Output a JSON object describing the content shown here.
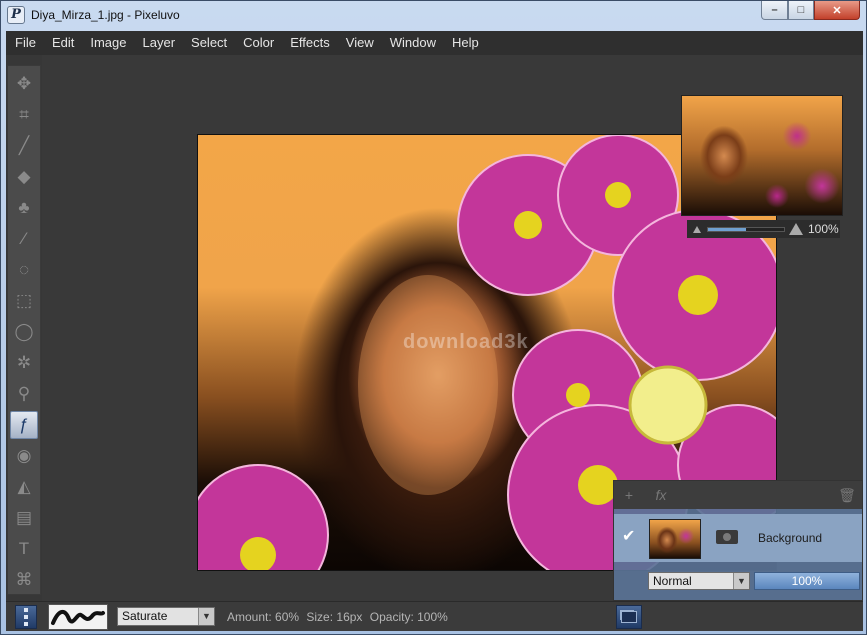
{
  "window": {
    "title": "Diya_Mirza_1.jpg - Pixeluvo",
    "app_icon": "P",
    "minimize": "–",
    "maximize": "□",
    "close": "✕"
  },
  "menu": [
    "File",
    "Edit",
    "Image",
    "Layer",
    "Select",
    "Color",
    "Effects",
    "View",
    "Window",
    "Help"
  ],
  "tools": [
    {
      "name": "move-icon",
      "glyph": "✥"
    },
    {
      "name": "crop-icon",
      "glyph": "⌗"
    },
    {
      "name": "brush-icon",
      "glyph": "╱"
    },
    {
      "name": "eraser-icon",
      "glyph": "◆"
    },
    {
      "name": "clone-stamp-icon",
      "glyph": "♣"
    },
    {
      "name": "heal-icon",
      "glyph": "⁄"
    },
    {
      "name": "lasso-icon",
      "glyph": "◌"
    },
    {
      "name": "rect-select-icon",
      "glyph": "⬚"
    },
    {
      "name": "ellipse-select-icon",
      "glyph": "◯"
    },
    {
      "name": "magic-wand-icon",
      "glyph": "✲"
    },
    {
      "name": "smudge-icon",
      "glyph": "⚲"
    },
    {
      "name": "effects-brush-icon",
      "glyph": "ƒ"
    },
    {
      "name": "red-eye-icon",
      "glyph": "◉"
    },
    {
      "name": "fill-bucket-icon",
      "glyph": "◭"
    },
    {
      "name": "gradient-icon",
      "glyph": "▤"
    },
    {
      "name": "text-icon",
      "glyph": "T"
    },
    {
      "name": "transform-icon",
      "glyph": "⌘"
    }
  ],
  "active_tool_index": 11,
  "canvas": {
    "watermark": "download3k"
  },
  "navigator": {
    "zoom_fraction": 0.5,
    "zoom_label": "100%"
  },
  "layers_panel": {
    "add_icon": "+",
    "fx_icon": "fx",
    "delete_icon": "🗑",
    "layer_check": "✔",
    "layer_name": "Background",
    "blend_mode": "Normal",
    "opacity": "100%"
  },
  "status": {
    "mode": "Saturate",
    "amount_label": "Amount: 60%",
    "size_label": "Size: 16px",
    "opacity_label": "Opacity: 100%"
  }
}
